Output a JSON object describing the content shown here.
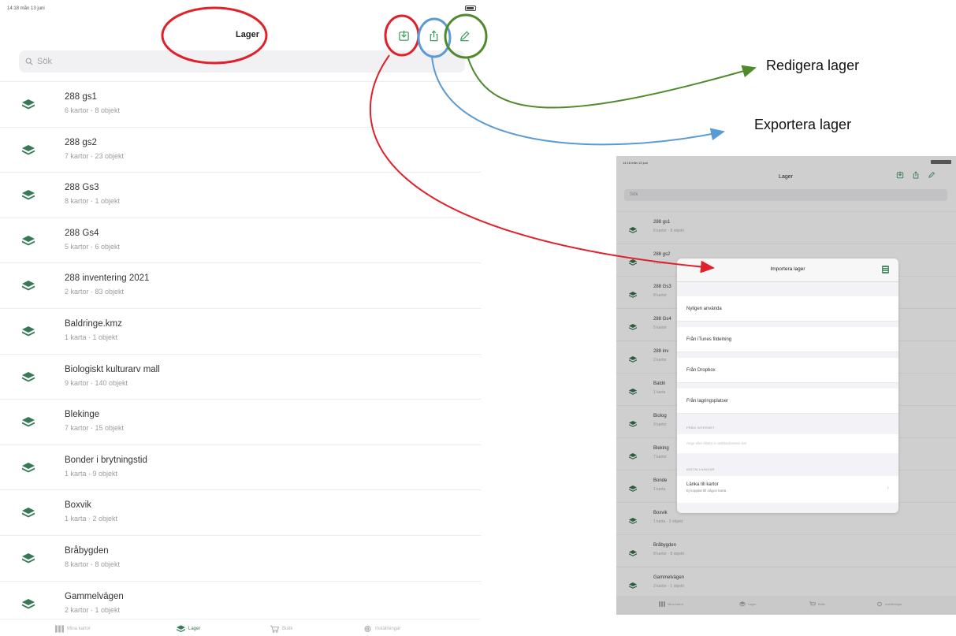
{
  "status": {
    "time": "14:18  mån 13 juni"
  },
  "nav": {
    "title": "Lager"
  },
  "search": {
    "placeholder": "Sök"
  },
  "layers": [
    {
      "name": "288 gs1",
      "meta": "6 kartor · 8 objekt"
    },
    {
      "name": "288 gs2",
      "meta": "7 kartor · 23 objekt"
    },
    {
      "name": "288 Gs3",
      "meta": "8 kartor · 1 objekt"
    },
    {
      "name": "288 Gs4",
      "meta": "5 kartor · 6 objekt"
    },
    {
      "name": "288 inventering 2021",
      "meta": "2 kartor · 83 objekt"
    },
    {
      "name": "Baldringe.kmz",
      "meta": "1 karta · 1 objekt"
    },
    {
      "name": "Biologiskt kulturarv mall",
      "meta": "9 kartor · 140 objekt"
    },
    {
      "name": "Blekinge",
      "meta": "7 kartor · 15 objekt"
    },
    {
      "name": "Bonder i brytningstid",
      "meta": "1 karta · 9 objekt"
    },
    {
      "name": "Boxvik",
      "meta": "1 karta · 2 objekt"
    },
    {
      "name": "Bråbygden",
      "meta": "8 kartor · 8 objekt"
    },
    {
      "name": "Gammelvägen",
      "meta": "2 kartor · 1 objekt"
    }
  ],
  "tabs": [
    {
      "label": "Mina kartor",
      "icon": "map-grid-icon",
      "active": false
    },
    {
      "label": "Lager",
      "icon": "layers-icon",
      "active": true
    },
    {
      "label": "Butik",
      "icon": "cart-icon",
      "active": false
    },
    {
      "label": "Inställningar",
      "icon": "gear-icon",
      "active": false
    }
  ],
  "annotations": {
    "edit": "Redigera lager",
    "export": "Exportera lager",
    "colors": {
      "import": "#e0202a",
      "export": "#5b9bd5",
      "edit": "#4f8a2c"
    }
  },
  "inset": {
    "title": "Lager",
    "search_placeholder": "Sök",
    "rows": [
      {
        "name": "288 gs1",
        "meta": "6 kartor · 8 objekt"
      },
      {
        "name": "288 gs2",
        "meta": "7 kartor"
      },
      {
        "name": "288 Gs3",
        "meta": "8 kartor"
      },
      {
        "name": "288 Gs4",
        "meta": "5 kartor"
      },
      {
        "name": "288 inv",
        "meta": "2 kartor"
      },
      {
        "name": "Baldri",
        "meta": "1 karta"
      },
      {
        "name": "Biolog",
        "meta": "9 kartor"
      },
      {
        "name": "Bleking",
        "meta": "7 kartor"
      },
      {
        "name": "Bonde",
        "meta": "1 karta"
      },
      {
        "name": "Boxvik",
        "meta": "1 karta · 2 objekt"
      },
      {
        "name": "Bråbygden",
        "meta": "8 kartor · 8 objekt"
      },
      {
        "name": "Gammelvägen",
        "meta": "2 kartor · 1 objekt"
      }
    ],
    "tabs": [
      "Mina kartor",
      "Lager",
      "Butik",
      "Inställningar"
    ],
    "modal": {
      "title": "Importera lager",
      "recent": "Nyligen använda",
      "itunes": "Från iTunes fildelning",
      "dropbox": "Från Dropbox",
      "storage": "Från lagringsplatser",
      "internet_header": "FRÅN INTERNET",
      "url_placeholder": "Ange eller klistra in webbadressen här",
      "settings_header": "INSTÄLLNINGAR",
      "link_title": "Länka till kartor",
      "link_sub": "Ej kopplat till någon karta",
      "chevron": "›"
    }
  }
}
